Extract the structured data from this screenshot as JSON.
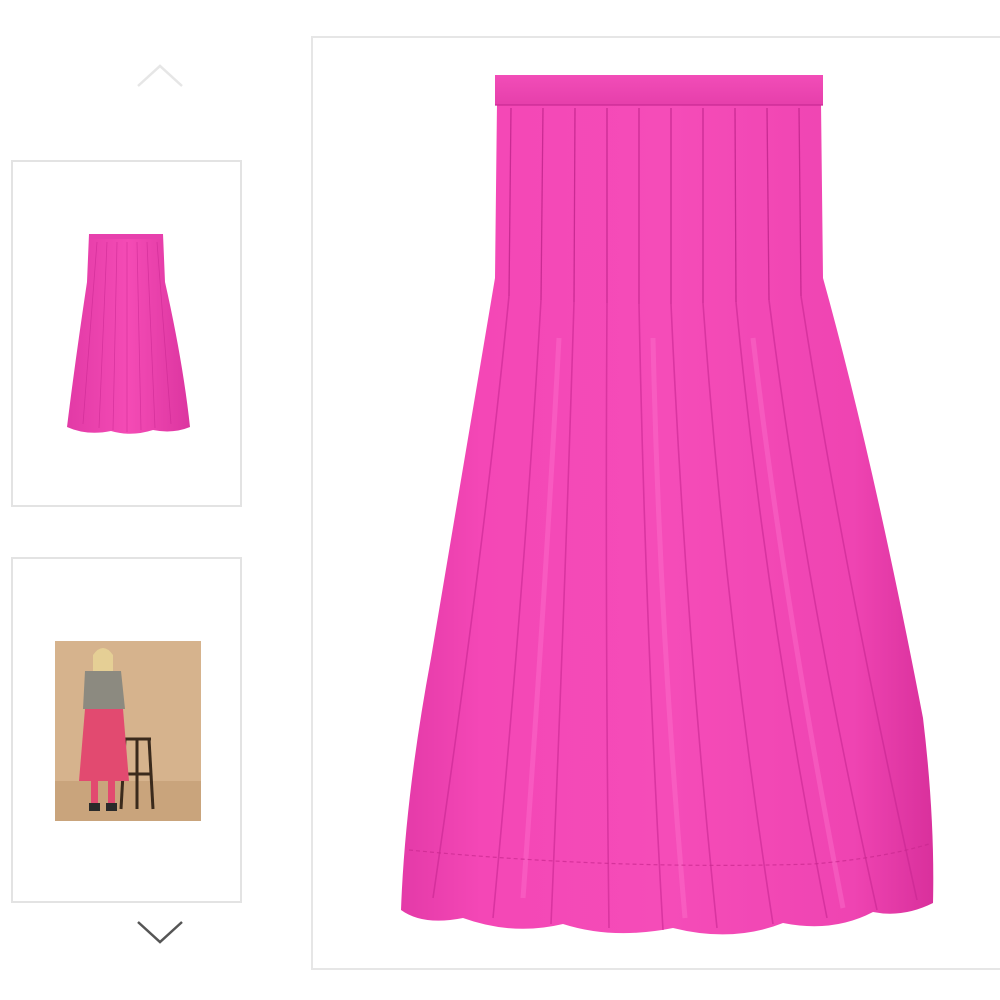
{
  "gallery": {
    "nav": {
      "up_icon": "chevron-up-icon",
      "down_icon": "chevron-down-icon"
    },
    "thumbnails": [
      {
        "icon": "skirt-product-thumbnail",
        "selected": true
      },
      {
        "icon": "model-lifestyle-thumbnail",
        "selected": false
      }
    ],
    "main_image": {
      "icon": "pink-pleated-skirt-image"
    }
  },
  "colors": {
    "skirt_pink": "#f03fb0",
    "skirt_shadow": "#d12a98",
    "skirt_highlight": "#ff6cc8",
    "border": "#e3e3e3",
    "chevron_disabled": "#e6e6e6",
    "chevron_active": "#555555",
    "photo_background": "#d6b38d"
  }
}
